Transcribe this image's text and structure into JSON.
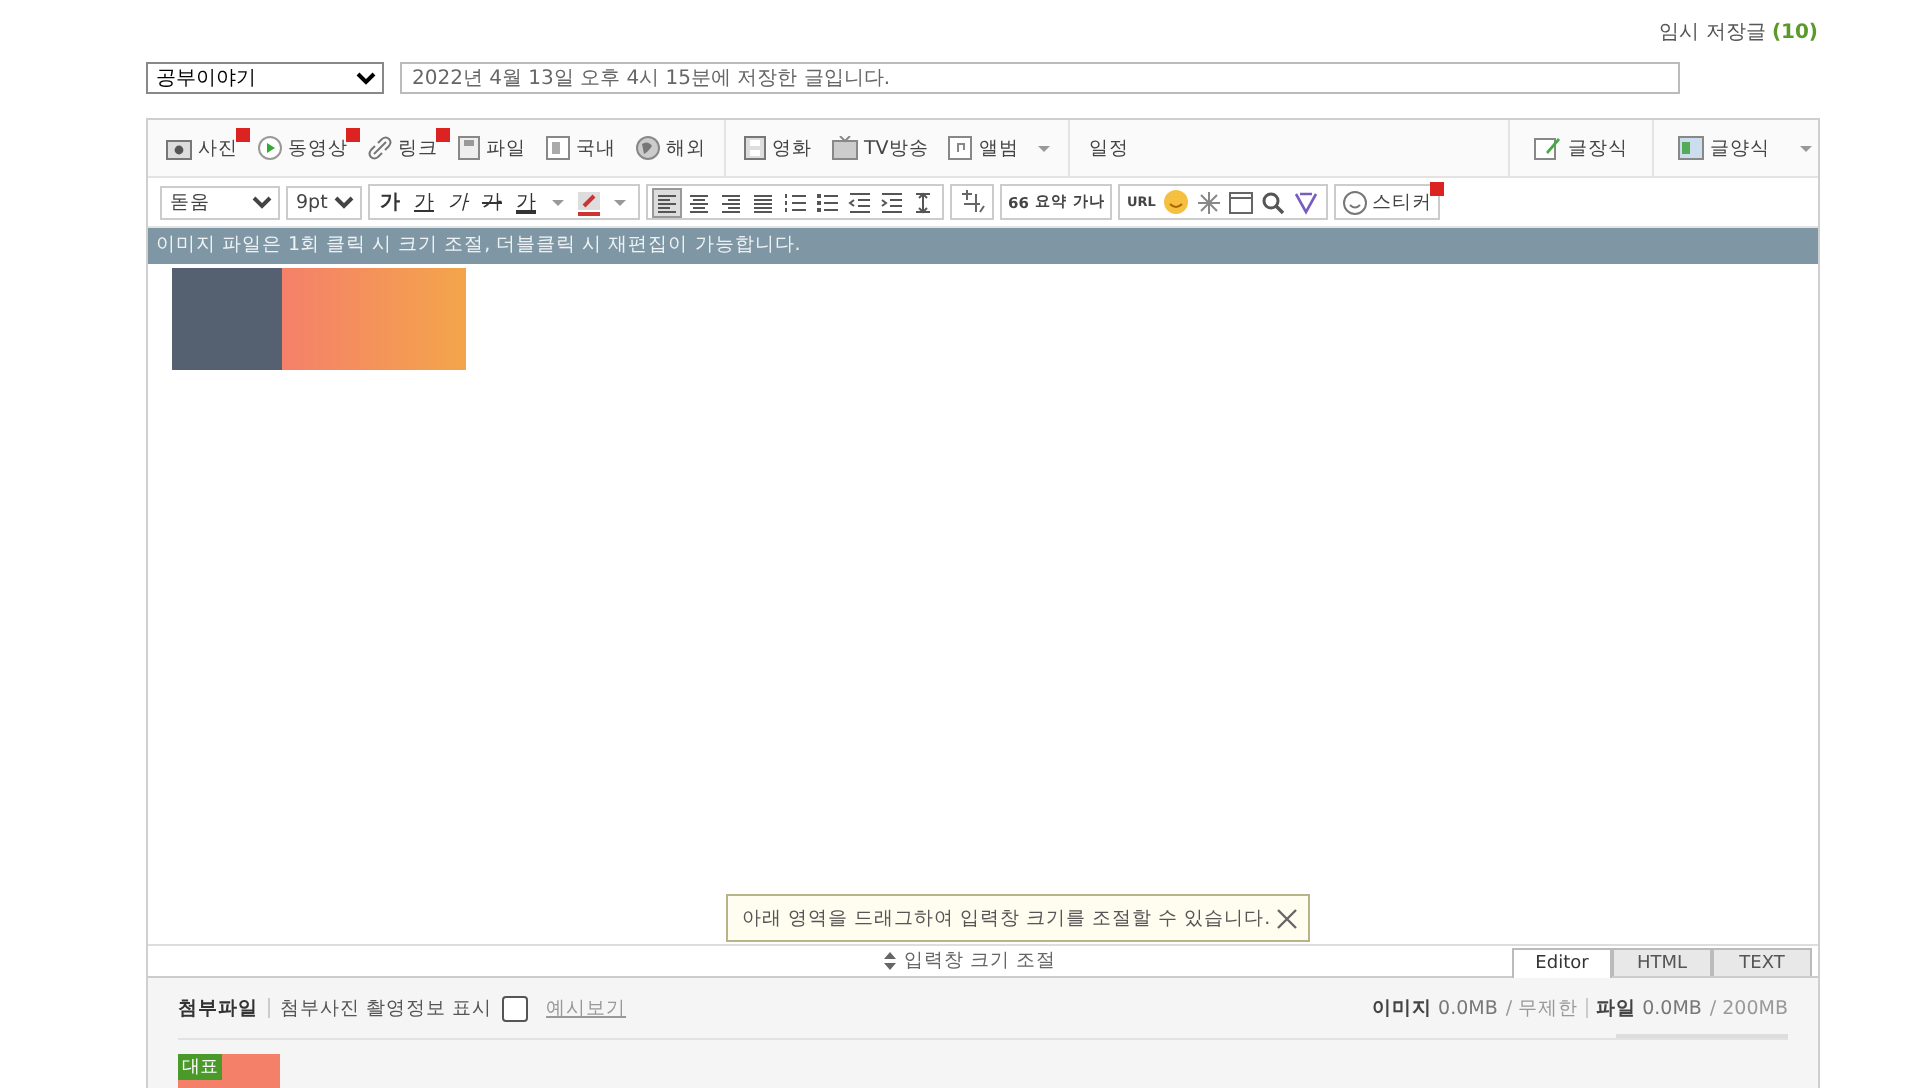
{
  "temp_saved": {
    "label": "임시 저장글",
    "count": "(10)"
  },
  "category": {
    "value": "공부이야기"
  },
  "title_field": {
    "value": "2022년 4월 13일 오후 4시 15분에 저장한 글입니다."
  },
  "insert_toolbar": {
    "groups": [
      [
        {
          "label": "사진",
          "new": true
        },
        {
          "label": "동영상",
          "new": true
        },
        {
          "label": "링크",
          "new": true
        },
        {
          "label": "파일",
          "new": false
        },
        {
          "label": "국내",
          "new": false
        },
        {
          "label": "해외",
          "new": false
        }
      ],
      [
        {
          "label": "영화",
          "new": false
        },
        {
          "label": "TV방송",
          "new": false
        },
        {
          "label": "앨범",
          "new": false
        }
      ],
      [
        {
          "label": "일정",
          "new": false
        }
      ]
    ],
    "right": [
      {
        "label": "글장식"
      },
      {
        "label": "글양식"
      }
    ]
  },
  "format_toolbar": {
    "font": "돋움",
    "size": "9pt",
    "styles": [
      {
        "label": "가",
        "kind": "bold"
      },
      {
        "label": "가",
        "kind": "underline"
      },
      {
        "label": "가",
        "kind": "italic"
      },
      {
        "label": "가",
        "kind": "strike"
      },
      {
        "label": "가",
        "kind": "color"
      }
    ],
    "quote": "66",
    "summary": "요약",
    "dict": "가나",
    "url": "URL",
    "sticker": {
      "label": "스티커",
      "new": true
    }
  },
  "info_bar": "이미지 파일은 1회 클릭 시 크기 조절, 더블클릭 시 재편집이 가능합니다.",
  "tooltip": "아래 영역을 드래그하여 입력창 크기를 조절할 수 있습니다.",
  "resize_label": "입력창 크기 조절",
  "mode_tabs": [
    {
      "label": "Editor",
      "selected": true
    },
    {
      "label": "HTML",
      "selected": false
    },
    {
      "label": "TEXT",
      "selected": false
    }
  ],
  "attachments": {
    "title": "첨부파일",
    "exif_label": "첨부사진 촬영정보 표시",
    "exif_checked": false,
    "preview_link": "예시보기",
    "image_label": "이미지",
    "image_size": "0.0MB",
    "image_limit": "/ 무제한",
    "file_label": "파일",
    "file_size": "0.0MB",
    "file_limit": "/ 200MB",
    "level": 0,
    "thumb_badge": "대표"
  }
}
